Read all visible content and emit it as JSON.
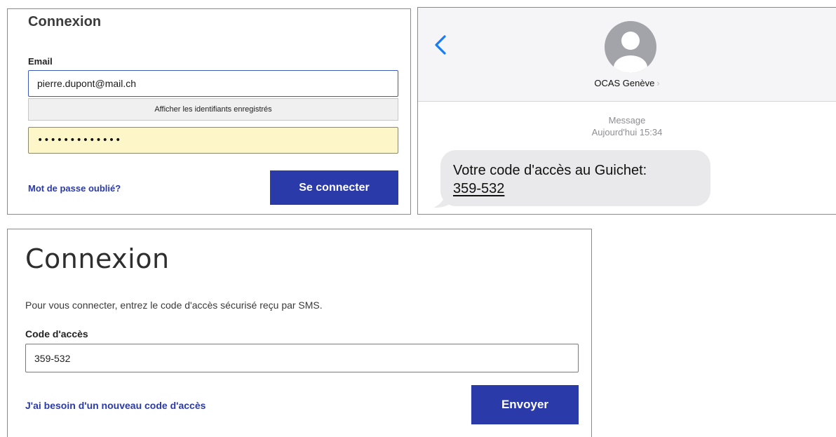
{
  "login": {
    "title": "Connexion",
    "email_label": "Email",
    "email_value": "pierre.dupont@mail.ch",
    "autofill_suggestion": "Afficher les identifiants enregistrés",
    "password_masked": "•••••••••••••",
    "forgot_password": "Mot de passe oublié?",
    "connect_button": "Se connecter",
    "colors": {
      "primary": "#2a3aa8",
      "autofill_bg": "#fdf6c8"
    }
  },
  "sms": {
    "back_icon": "chevron-left-icon",
    "avatar_icon": "person-avatar-icon",
    "contact_name": "OCAS Genève",
    "contact_chevron": "›",
    "message_type": "Message",
    "message_time": "Aujourd'hui 15:34",
    "message_text": "Votre code d'accès au Guichet:",
    "message_code": "359-532",
    "colors": {
      "ios_blue": "#1a7cf5",
      "bubble": "#e9e9eb"
    }
  },
  "code_entry": {
    "title": "Connexion",
    "instructions": "Pour vous connecter, entrez le code d'accès sécurisé reçu par SMS.",
    "code_label": "Code d'accès",
    "code_value": "359-532",
    "new_code_link": "J'ai besoin d'un nouveau code d'accès",
    "send_button": "Envoyer"
  }
}
